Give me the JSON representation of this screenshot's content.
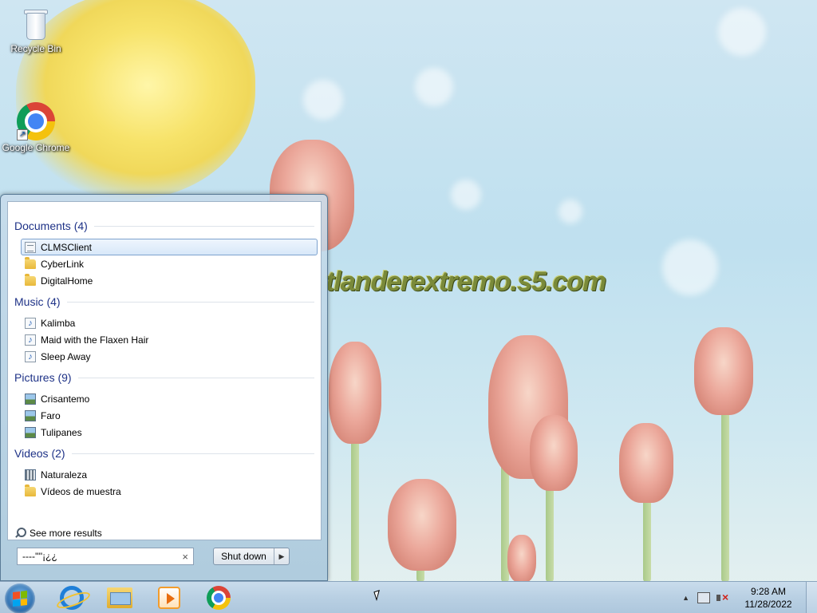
{
  "desktop": {
    "icons": [
      {
        "label": "Recycle Bin",
        "icon": "recycle-bin-icon"
      },
      {
        "label": "Google Chrome",
        "icon": "chrome-icon"
      }
    ],
    "watermark": "tlanderextremo.s5.com"
  },
  "start_menu": {
    "groups": [
      {
        "header": "Documents (4)",
        "items": [
          {
            "label": "CLMSClient",
            "icon": "document-icon",
            "selected": true
          },
          {
            "label": "CyberLink",
            "icon": "folder-icon"
          },
          {
            "label": "DigitalHome",
            "icon": "folder-icon"
          }
        ]
      },
      {
        "header": "Music (4)",
        "items": [
          {
            "label": "Kalimba",
            "icon": "music-file-icon"
          },
          {
            "label": "Maid with the Flaxen Hair",
            "icon": "music-file-icon"
          },
          {
            "label": "Sleep Away",
            "icon": "music-file-icon"
          }
        ]
      },
      {
        "header": "Pictures (9)",
        "items": [
          {
            "label": "Crisantemo",
            "icon": "picture-file-icon"
          },
          {
            "label": "Faro",
            "icon": "picture-file-icon"
          },
          {
            "label": "Tulipanes",
            "icon": "picture-file-icon"
          }
        ]
      },
      {
        "header": "Videos (2)",
        "items": [
          {
            "label": "Naturaleza",
            "icon": "video-file-icon"
          },
          {
            "label": "Vídeos de muestra",
            "icon": "folder-icon"
          }
        ]
      }
    ],
    "see_more": "See more results",
    "search_value": "----''''¡¿¿",
    "clear_glyph": "×",
    "shutdown_label": "Shut down",
    "shutdown_arrow": "▶"
  },
  "taskbar": {
    "pinned": [
      "start-orb",
      "internet-explorer-icon",
      "windows-explorer-icon",
      "media-player-icon",
      "chrome-icon"
    ],
    "tray": {
      "chevron": "▲",
      "time": "9:28 AM",
      "date": "11/28/2022"
    }
  },
  "colors": {
    "group_header": "#1e3287",
    "selection_border": "#7da2ce",
    "taskbar": "#b9d0e3"
  }
}
